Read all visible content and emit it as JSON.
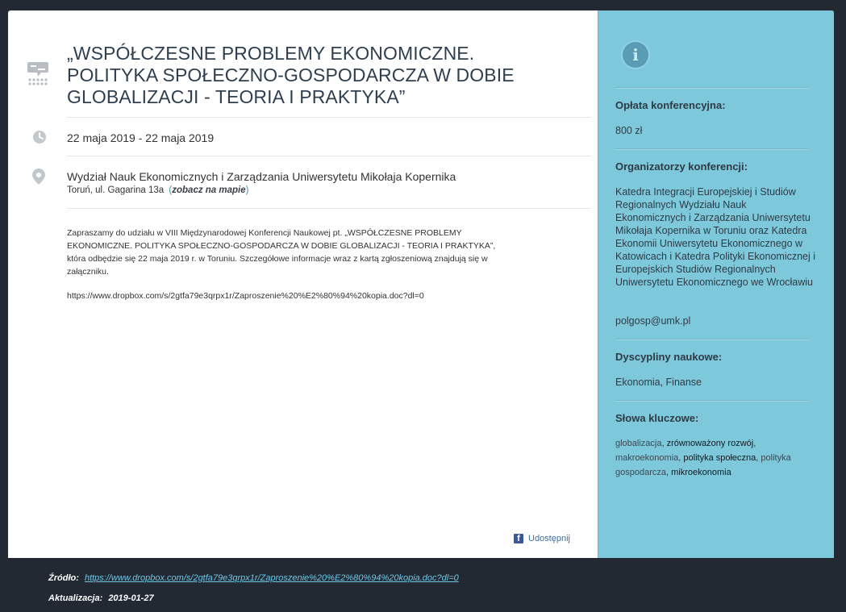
{
  "event": {
    "title": "„WSPÓŁCZESNE PROBLEMY EKONOMICZNE. POLITYKA SPOŁECZNO-GOSPODARCZA W DOBIE GLOBALIZACJI - TEORIA I PRAKTYKA”",
    "date": "22 maja 2019 - 22 maja 2019",
    "venue": "Wydział Nauk Ekonomicznych i Zarządzania Uniwersytetu Mikołaja Kopernika",
    "address": "Toruń, ul. Gagarina 13a",
    "map_link": "zobacz na mapie",
    "description": "Zapraszamy do udziału w VIII Międzynarodowej Konferencji Naukowej pt. „WSPÓŁCZESNE PROBLEMY EKONOMICZNE. POLITYKA SPOŁECZNO-GOSPODARCZA W DOBIE GLOBALIZACJI - TEORIA I PRAKTYKA”, która odbędzie się 22 maja 2019 r. w Toruniu. Szczegółowe informacje wraz z kartą zgłoszeniową znajdują się w załączniku.",
    "attachment_link": "https://www.dropbox.com/s/2gtfa79e3qrpx1r/Zaproszenie%20%E2%80%94%20kopia.doc?dl=0",
    "share_label": "Udostępnij"
  },
  "sidebar": {
    "fee_label": "Opłata konferencyjna:",
    "fee_value": "800 zł",
    "organizers_label": "Organizatorzy konferencji:",
    "organizers_value": "Katedra Integracji Europejskiej i Studiów Regionalnych Wydziału Nauk Ekonomicznych i Zarządzania Uniwersytetu Mikołaja Kopernika w Toruniu oraz Katedra Ekonomii Uniwersytetu Ekonomicznego w Katowicach  i Katedra Polityki Ekonomicznej i Europejskich Studiów Regionalnych Uniwersytetu Ekonomicznego we Wrocławiu",
    "email": "polgosp@umk.pl",
    "disciplines_label": "Dyscypliny naukowe:",
    "disciplines_value": "Ekonomia, Finanse",
    "keywords_label": "Słowa kluczowe:",
    "keywords": [
      "globalizacja",
      "zrównoważony rozwój",
      "makroekonomia",
      "polityka społeczna",
      "polityka gospodarcza",
      "mikroekonomia"
    ]
  },
  "footer": {
    "source_label": "Źródło:",
    "source_url": "https://www.dropbox.com/s/2gtfa79e3qrpx1r/Zaproszenie%20%E2%80%94%20kopia.doc?dl=0",
    "updated_label": "Aktualizacja:",
    "updated_value": "2019-01-27"
  },
  "icons": [
    "conference-icon",
    "clock-icon",
    "map-pin-icon",
    "facebook-icon",
    "info-icon"
  ],
  "colors": {
    "sidebar_bg": "#7ec8dc",
    "page_bg": "#222933",
    "link": "#6cc8e8"
  }
}
